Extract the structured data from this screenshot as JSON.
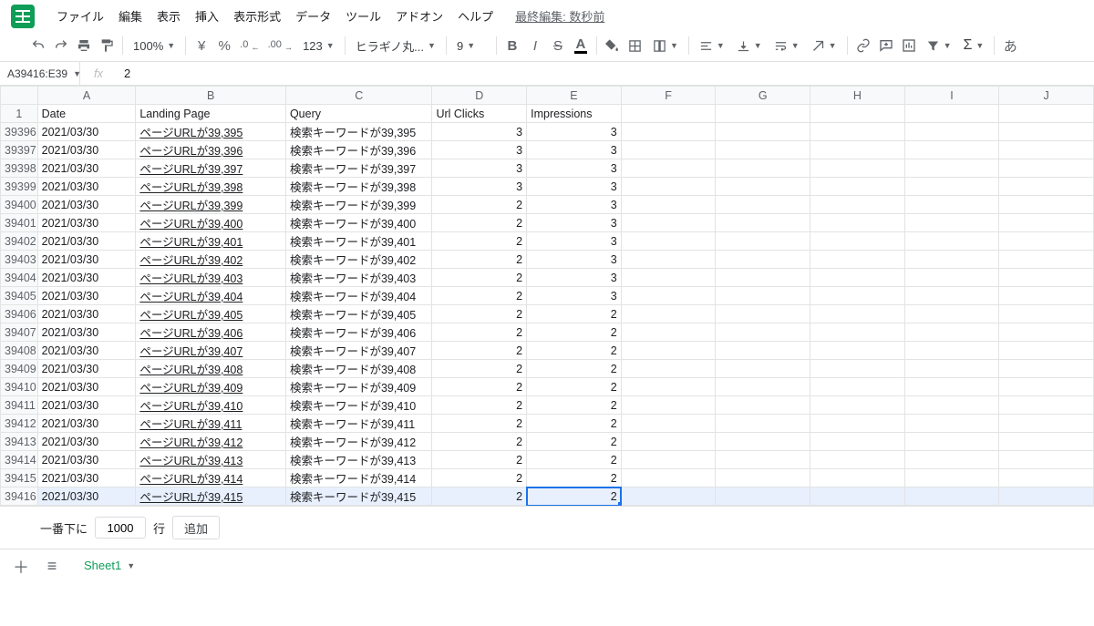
{
  "menu": {
    "items": [
      "ファイル",
      "編集",
      "表示",
      "挿入",
      "表示形式",
      "データ",
      "ツール",
      "アドオン",
      "ヘルプ"
    ],
    "last_edit": "最終編集: 数秒前"
  },
  "toolbar": {
    "zoom": "100%",
    "currency": "¥",
    "percent": "%",
    "dec_dec": ".0",
    "inc_dec": ".00",
    "numfmt": "123",
    "font": "ヒラギノ丸...",
    "fontsize": "9"
  },
  "fx": {
    "namebox": "A39416:E39",
    "label": "fx",
    "value": "2"
  },
  "columns": [
    "A",
    "B",
    "C",
    "D",
    "E",
    "F",
    "G",
    "H",
    "I",
    "J"
  ],
  "header_cells": [
    "Date",
    "Landing Page",
    "Query",
    "Url Clicks",
    "Impressions"
  ],
  "header_rownum": "1",
  "rows": [
    {
      "n": "39396",
      "a": "2021/03/30",
      "b": "ページURLが39,395",
      "c": "検索キーワードが39,395",
      "d": "3",
      "e": "3"
    },
    {
      "n": "39397",
      "a": "2021/03/30",
      "b": "ページURLが39,396",
      "c": "検索キーワードが39,396",
      "d": "3",
      "e": "3"
    },
    {
      "n": "39398",
      "a": "2021/03/30",
      "b": "ページURLが39,397",
      "c": "検索キーワードが39,397",
      "d": "3",
      "e": "3"
    },
    {
      "n": "39399",
      "a": "2021/03/30",
      "b": "ページURLが39,398",
      "c": "検索キーワードが39,398",
      "d": "3",
      "e": "3"
    },
    {
      "n": "39400",
      "a": "2021/03/30",
      "b": "ページURLが39,399",
      "c": "検索キーワードが39,399",
      "d": "2",
      "e": "3"
    },
    {
      "n": "39401",
      "a": "2021/03/30",
      "b": "ページURLが39,400",
      "c": "検索キーワードが39,400",
      "d": "2",
      "e": "3"
    },
    {
      "n": "39402",
      "a": "2021/03/30",
      "b": "ページURLが39,401",
      "c": "検索キーワードが39,401",
      "d": "2",
      "e": "3"
    },
    {
      "n": "39403",
      "a": "2021/03/30",
      "b": "ページURLが39,402",
      "c": "検索キーワードが39,402",
      "d": "2",
      "e": "3"
    },
    {
      "n": "39404",
      "a": "2021/03/30",
      "b": "ページURLが39,403",
      "c": "検索キーワードが39,403",
      "d": "2",
      "e": "3"
    },
    {
      "n": "39405",
      "a": "2021/03/30",
      "b": "ページURLが39,404",
      "c": "検索キーワードが39,404",
      "d": "2",
      "e": "3"
    },
    {
      "n": "39406",
      "a": "2021/03/30",
      "b": "ページURLが39,405",
      "c": "検索キーワードが39,405",
      "d": "2",
      "e": "2"
    },
    {
      "n": "39407",
      "a": "2021/03/30",
      "b": "ページURLが39,406",
      "c": "検索キーワードが39,406",
      "d": "2",
      "e": "2"
    },
    {
      "n": "39408",
      "a": "2021/03/30",
      "b": "ページURLが39,407",
      "c": "検索キーワードが39,407",
      "d": "2",
      "e": "2"
    },
    {
      "n": "39409",
      "a": "2021/03/30",
      "b": "ページURLが39,408",
      "c": "検索キーワードが39,408",
      "d": "2",
      "e": "2"
    },
    {
      "n": "39410",
      "a": "2021/03/30",
      "b": "ページURLが39,409",
      "c": "検索キーワードが39,409",
      "d": "2",
      "e": "2"
    },
    {
      "n": "39411",
      "a": "2021/03/30",
      "b": "ページURLが39,410",
      "c": "検索キーワードが39,410",
      "d": "2",
      "e": "2"
    },
    {
      "n": "39412",
      "a": "2021/03/30",
      "b": "ページURLが39,411",
      "c": "検索キーワードが39,411",
      "d": "2",
      "e": "2"
    },
    {
      "n": "39413",
      "a": "2021/03/30",
      "b": "ページURLが39,412",
      "c": "検索キーワードが39,412",
      "d": "2",
      "e": "2"
    },
    {
      "n": "39414",
      "a": "2021/03/30",
      "b": "ページURLが39,413",
      "c": "検索キーワードが39,413",
      "d": "2",
      "e": "2"
    },
    {
      "n": "39415",
      "a": "2021/03/30",
      "b": "ページURLが39,414",
      "c": "検索キーワードが39,414",
      "d": "2",
      "e": "2"
    },
    {
      "n": "39416",
      "a": "2021/03/30",
      "b": "ページURLが39,415",
      "c": "検索キーワードが39,415",
      "d": "2",
      "e": "2",
      "selected": true
    }
  ],
  "addrows": {
    "prefix": "一番下に",
    "count": "1000",
    "suffix": "行",
    "button": "追加"
  },
  "tabs": {
    "sheet1": "Sheet1"
  }
}
